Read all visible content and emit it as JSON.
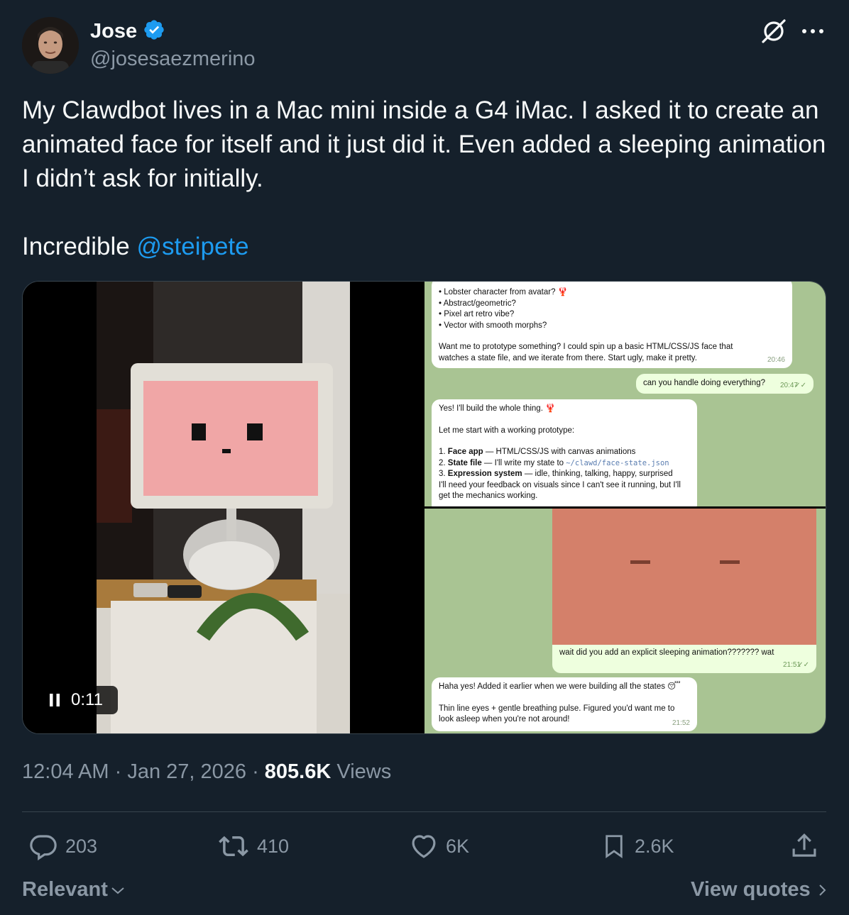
{
  "author": {
    "name": "Jose",
    "handle": "@josesaezmerino",
    "verified_icon": "verified-badge-icon",
    "verified_color": "#1d9bf0"
  },
  "tweet": {
    "line1": "My Clawdbot lives in a Mac mini inside a G4 iMac. I asked it to create an animated face for itself and it just did it. Even added a sleeping animation I didn’t ask for initially.",
    "line2_prefix": "Incredible ",
    "mention": "@steipete"
  },
  "video": {
    "time": "0:11",
    "state_icon": "pause-icon"
  },
  "chat_top": {
    "bullets": [
      "• Lobster character from avatar? 🦞",
      "• Abstract/geometric?",
      "• Pixel art retro vibe?",
      "• Vector with smooth morphs?"
    ],
    "msg1": "Want me to prototype something? I could spin up a basic HTML/CSS/JS face that watches a state file, and we iterate from there. Start ugly, make it pretty.",
    "msg1_time": "20:46",
    "user_msg": "can you handle doing everything?",
    "user_time": "20:47",
    "reply_intro": "Yes! I'll build the whole thing. 🦞",
    "reply_lead": "Let me start with a working prototype:",
    "items": [
      {
        "num": "1. ",
        "bold": "Face app",
        "rest": " — HTML/CSS/JS with canvas animations"
      },
      {
        "num": "2. ",
        "bold": "State file",
        "rest": " — I'll write my state to ",
        "code": "~/clawd/face-state.json"
      },
      {
        "num": "3. ",
        "bold": "Expression system",
        "rest": " — idle, thinking, talking, happy, surprised"
      }
    ],
    "reply_tail": "I'll need your feedback on visuals since I can't see it running, but I'll get the mechanics working."
  },
  "chat_bottom": {
    "user_msg": "wait did you add an explicit sleeping animation??????? wat",
    "user_time": "21:51",
    "reply1": "Haha yes! Added it earlier when we were building all the states 😴",
    "reply2": "Thin line eyes + gentle breathing pulse. Figured you'd want me to look asleep when you're not around!",
    "reply_time": "21:52"
  },
  "meta": {
    "time": "12:04 AM",
    "sep": " · ",
    "date": "Jan 27, 2026",
    "views_count": "805.6K",
    "views_label": " Views"
  },
  "actions": {
    "replies": "203",
    "reposts": "410",
    "likes": "6K",
    "bookmarks": "2.6K"
  },
  "footer": {
    "sort_label": "Relevant",
    "quotes_label": "View quotes"
  },
  "colors": {
    "background": "#15202b",
    "muted": "#8b98a5",
    "accent": "#1d9bf0"
  }
}
